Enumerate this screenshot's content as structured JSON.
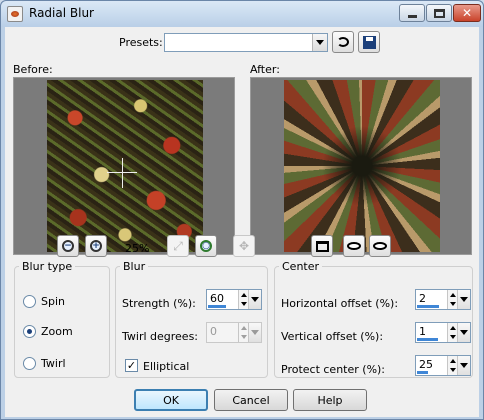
{
  "window": {
    "title": "Radial Blur",
    "icon": "radial-blur-app-icon"
  },
  "presets": {
    "label": "Presets:",
    "value": "",
    "reset_icon": "reset-arrow-icon",
    "save_icon": "floppy-save-icon"
  },
  "preview": {
    "before_label": "Before:",
    "after_label": "After:",
    "zoom_level": "25%"
  },
  "blur_type": {
    "legend": "Blur type",
    "options": [
      {
        "label": "Spin",
        "selected": false
      },
      {
        "label": "Zoom",
        "selected": true
      },
      {
        "label": "Twirl",
        "selected": false
      }
    ]
  },
  "blur": {
    "legend": "Blur",
    "strength_label": "Strength (%):",
    "strength_value": "60",
    "strength_percent": 60,
    "twirl_label": "Twirl degrees:",
    "twirl_value": "0",
    "twirl_enabled": false,
    "elliptical_label": "Elliptical",
    "elliptical_checked": true
  },
  "center": {
    "legend": "Center",
    "h_label": "Horizontal offset (%):",
    "h_value": "2",
    "v_label": "Vertical offset (%):",
    "v_value": "1",
    "protect_label": "Protect center (%):",
    "protect_value": "25"
  },
  "buttons": {
    "ok": "OK",
    "cancel": "Cancel",
    "help": "Help"
  },
  "colors": {
    "accent": "#3c7fb1",
    "slider_fill": "#3f86d6",
    "title_bar": "#bcd0e6"
  }
}
